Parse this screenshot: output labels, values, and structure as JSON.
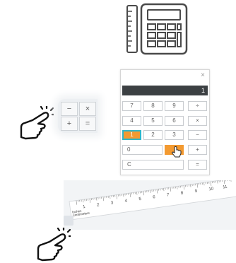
{
  "calculator": {
    "display_value": "1",
    "close_symbol": "×",
    "keys": {
      "seven": "7",
      "eight": "8",
      "nine": "9",
      "divide": "÷",
      "four": "4",
      "five": "5",
      "six": "6",
      "multiply": "×",
      "one": "1",
      "two": "2",
      "three": "3",
      "minus": "−",
      "zero": "0",
      "plus": "+",
      "clear": "C",
      "equals": "="
    }
  },
  "mini_pad": {
    "minus": "−",
    "times": "×",
    "plus": "+",
    "equals": "="
  },
  "ruler": {
    "inch_numbers": [
      "1",
      "2",
      "3",
      "4",
      "5",
      "6",
      "7",
      "8",
      "9",
      "10",
      "11"
    ],
    "inches_label": "Inches",
    "centimeters_label": "Centimeters"
  },
  "colors": {
    "accent_orange": "#f39a31",
    "focus_teal": "#30b5c7",
    "display_bg": "#3c4043"
  },
  "icons": [
    "calculator-ruler-icon",
    "tap-hand-icon"
  ]
}
